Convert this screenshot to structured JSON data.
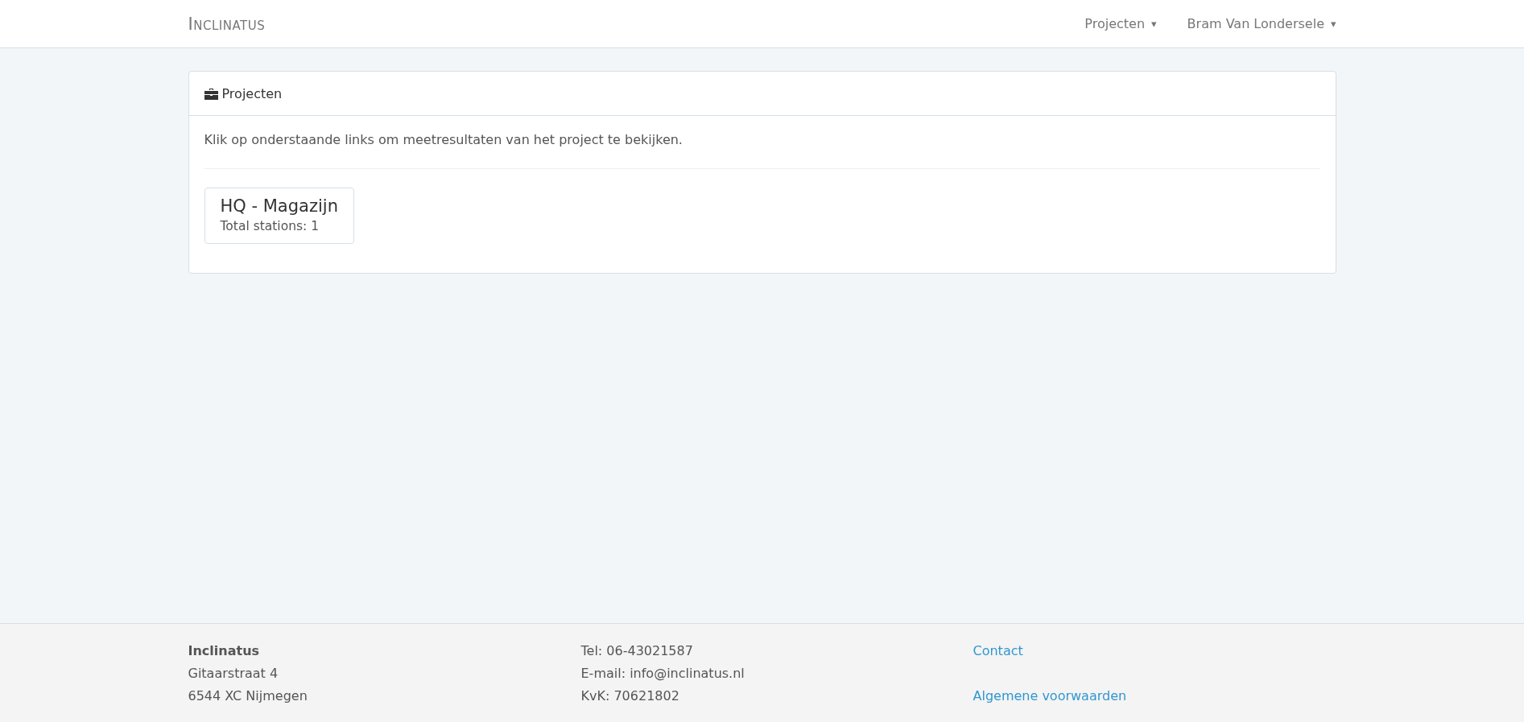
{
  "navbar": {
    "brand": "Inclinatus",
    "menus": [
      {
        "label": "Projecten",
        "caret": "▾"
      },
      {
        "label": "Bram Van Londersele",
        "caret": "▾"
      }
    ]
  },
  "panel": {
    "title": "Projecten",
    "intro": "Klik op onderstaande links om meetresultaten van het project te bekijken.",
    "projects": [
      {
        "name": "HQ - Magazijn",
        "stations": "Total stations: 1"
      }
    ]
  },
  "footer": {
    "company": {
      "name": "Inclinatus",
      "lines": [
        "Gitaarstraat 4",
        "6544 XC Nijmegen"
      ]
    },
    "contact_lines": [
      "Tel: 06-43021587",
      "E-mail: info@inclinatus.nl",
      "KvK: 70621802"
    ],
    "links": [
      "Contact",
      "Algemene voorwaarden"
    ]
  }
}
